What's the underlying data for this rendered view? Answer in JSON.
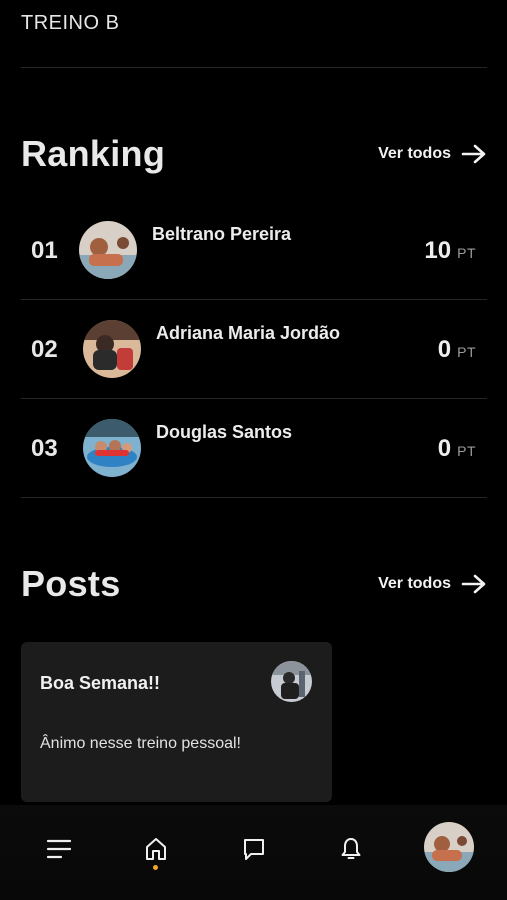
{
  "top": {
    "current_item": "TREINO B"
  },
  "ranking": {
    "title": "Ranking",
    "see_all": "Ver todos",
    "rows": [
      {
        "position": "01",
        "name": "Beltrano Pereira",
        "score": "10",
        "unit": "PT"
      },
      {
        "position": "02",
        "name": "Adriana Maria Jordão",
        "score": "0",
        "unit": "PT"
      },
      {
        "position": "03",
        "name": "Douglas Santos",
        "score": "0",
        "unit": "PT"
      }
    ]
  },
  "posts": {
    "title": "Posts",
    "see_all": "Ver todos",
    "items": [
      {
        "title": "Boa Semana!!",
        "body": "Ânimo nesse treino pessoal!"
      }
    ]
  },
  "nav": {
    "items": [
      "menu-icon",
      "home-icon",
      "chat-icon",
      "bell-icon",
      "profile-avatar"
    ],
    "active": "home-icon",
    "indicator_color": "#f5a623"
  },
  "colors": {
    "background": "#000000",
    "card": "#1c1c1c",
    "divider": "#262626",
    "text": "#ffffff",
    "muted": "#9c9c9c"
  }
}
